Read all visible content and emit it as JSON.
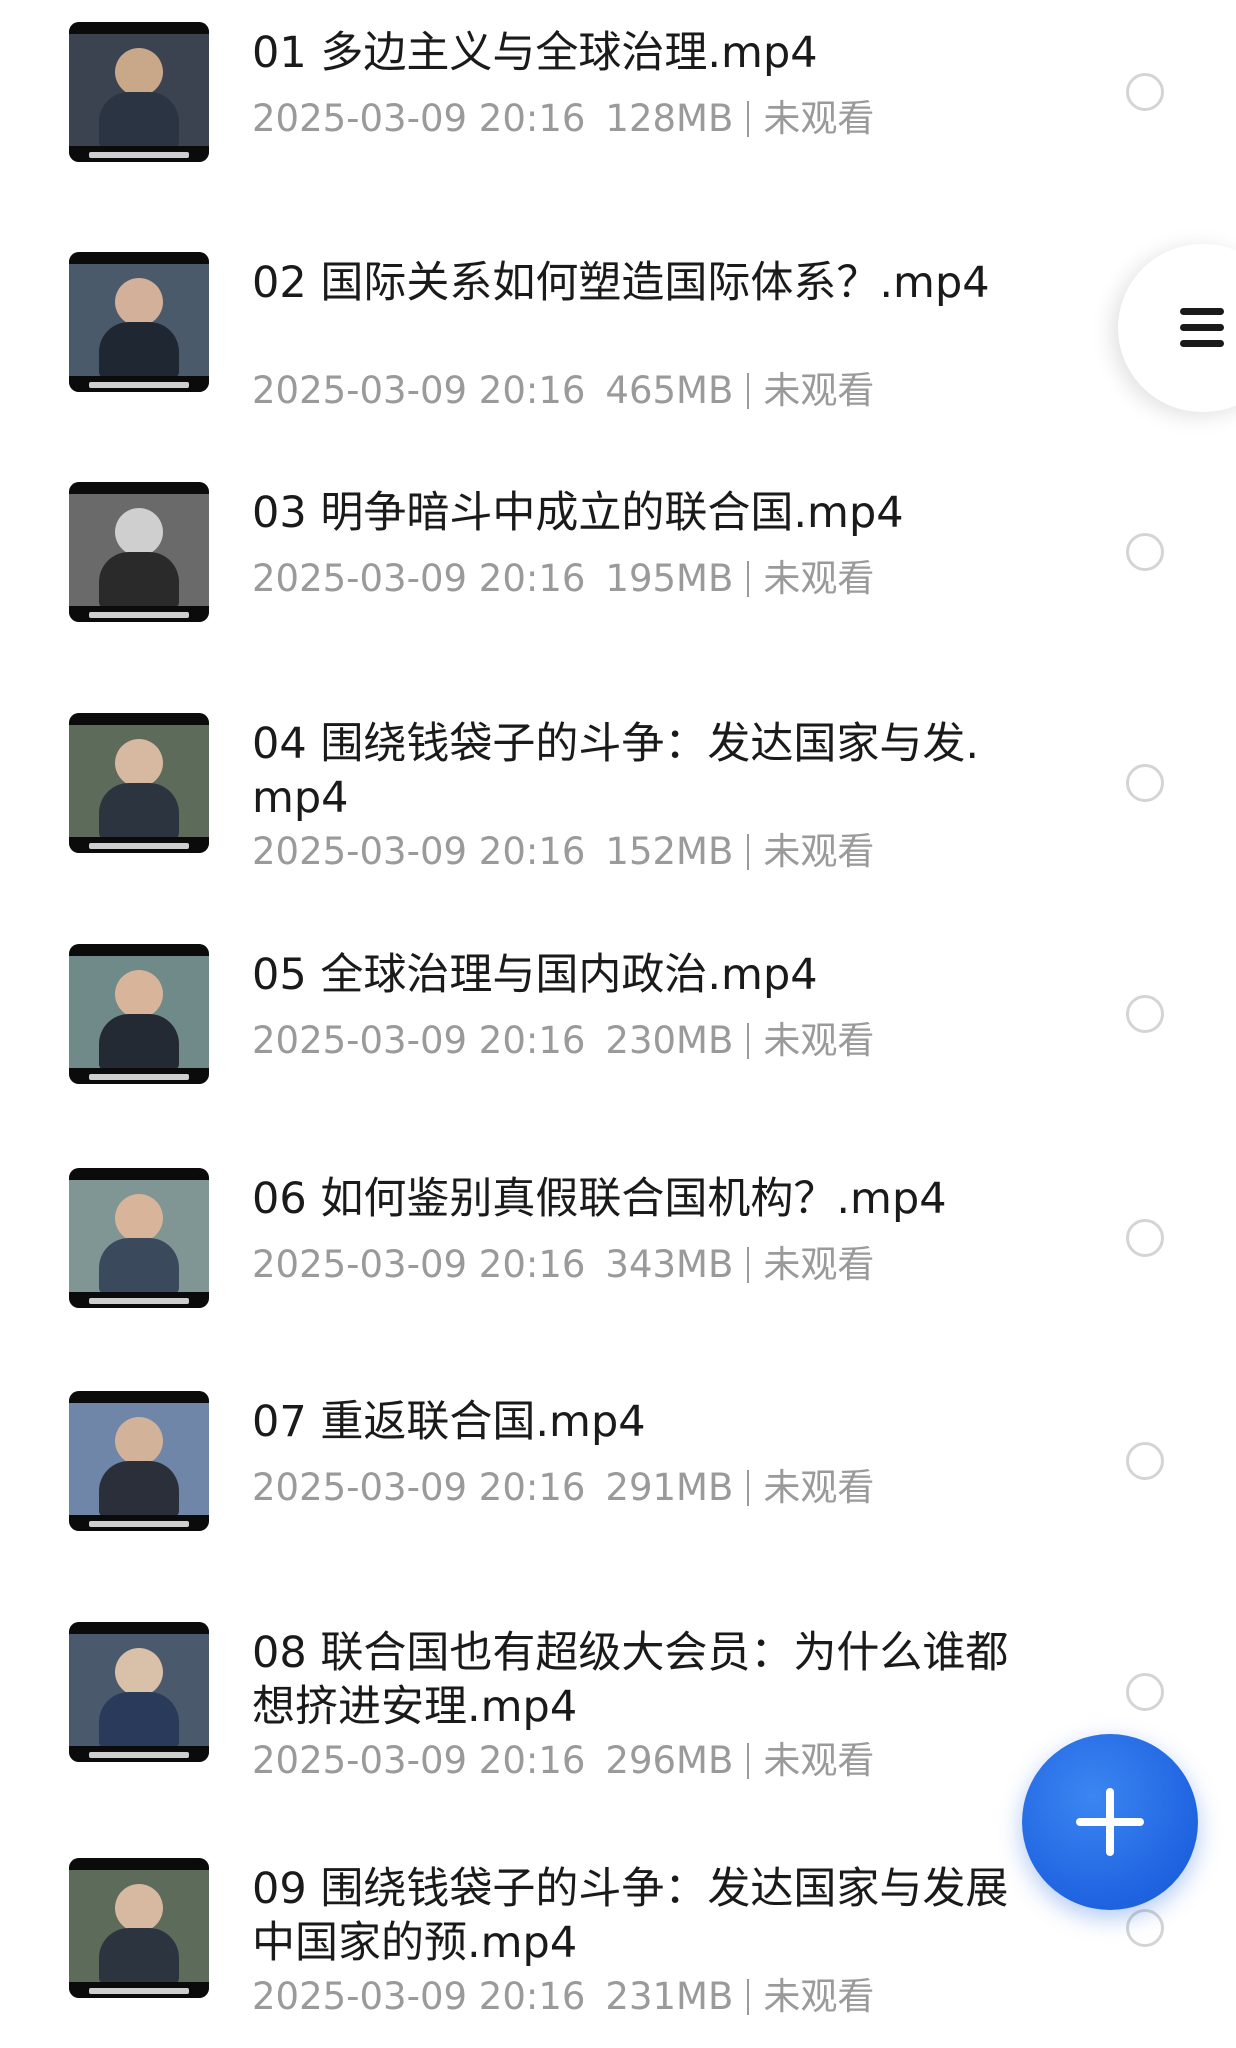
{
  "files": [
    {
      "title": "01 多边主义与全球治理.mp4",
      "date": "2025-03-09 20:16",
      "size": "128MB",
      "status": "未观看",
      "thumb": {
        "bg": "#3b4250",
        "figure": "#c9a88a",
        "body": "#2b3442"
      }
    },
    {
      "title": "02 国际关系如何塑造国际体系？.mp4",
      "date": "2025-03-09 20:16",
      "size": "465MB",
      "status": "未观看",
      "thumb": {
        "bg": "#4a5a6a",
        "figure": "#d2b09a",
        "body": "#1f2733"
      }
    },
    {
      "title": "03 明争暗斗中成立的联合国.mp4",
      "date": "2025-03-09 20:16",
      "size": "195MB",
      "status": "未观看",
      "thumb": {
        "bg": "#6a6a6a",
        "figure": "#cfcfcf",
        "body": "#2a2a2a"
      }
    },
    {
      "title": "04 围绕钱袋子的斗争：发达国家与发.mp4",
      "date": "2025-03-09 20:16",
      "size": "152MB",
      "status": "未观看",
      "thumb": {
        "bg": "#5c6b5a",
        "figure": "#d6b9a0",
        "body": "#2c3440"
      }
    },
    {
      "title": "05 全球治理与国内政治.mp4",
      "date": "2025-03-09 20:16",
      "size": "230MB",
      "status": "未观看",
      "thumb": {
        "bg": "#6f8a88",
        "figure": "#d8b49a",
        "body": "#232a33"
      }
    },
    {
      "title": "06 如何鉴别真假联合国机构？.mp4",
      "date": "2025-03-09 20:16",
      "size": "343MB",
      "status": "未观看",
      "thumb": {
        "bg": "#7f9694",
        "figure": "#d8b49a",
        "body": "#3a4a5c"
      }
    },
    {
      "title": "07 重返联合国.mp4",
      "date": "2025-03-09 20:16",
      "size": "291MB",
      "status": "未观看",
      "thumb": {
        "bg": "#6f86a8",
        "figure": "#d2b39a",
        "body": "#2a2f3a"
      }
    },
    {
      "title": "08 联合国也有超级大会员：为什么谁都想挤进安理.mp4",
      "date": "2025-03-09 20:16",
      "size": "296MB",
      "status": "未观看",
      "thumb": {
        "bg": "#4a5a6c",
        "figure": "#d9c0a8",
        "body": "#2a3a5a"
      }
    },
    {
      "title": "09 围绕钱袋子的斗争：发达国家与发展中国家的预.mp4",
      "date": "2025-03-09 20:16",
      "size": "231MB",
      "status": "未观看",
      "thumb": {
        "bg": "#5c6b5a",
        "figure": "#d6b9a0",
        "body": "#2c3440"
      }
    }
  ],
  "colors": {
    "title": "#1a1a1a",
    "meta": "#9a9a9a",
    "radio_border": "#d4d4d4",
    "fab": "#1f63e0"
  },
  "icons": {
    "menu": "hamburger-menu-icon",
    "fab": "plus-icon",
    "select": "radio-circle-icon"
  }
}
